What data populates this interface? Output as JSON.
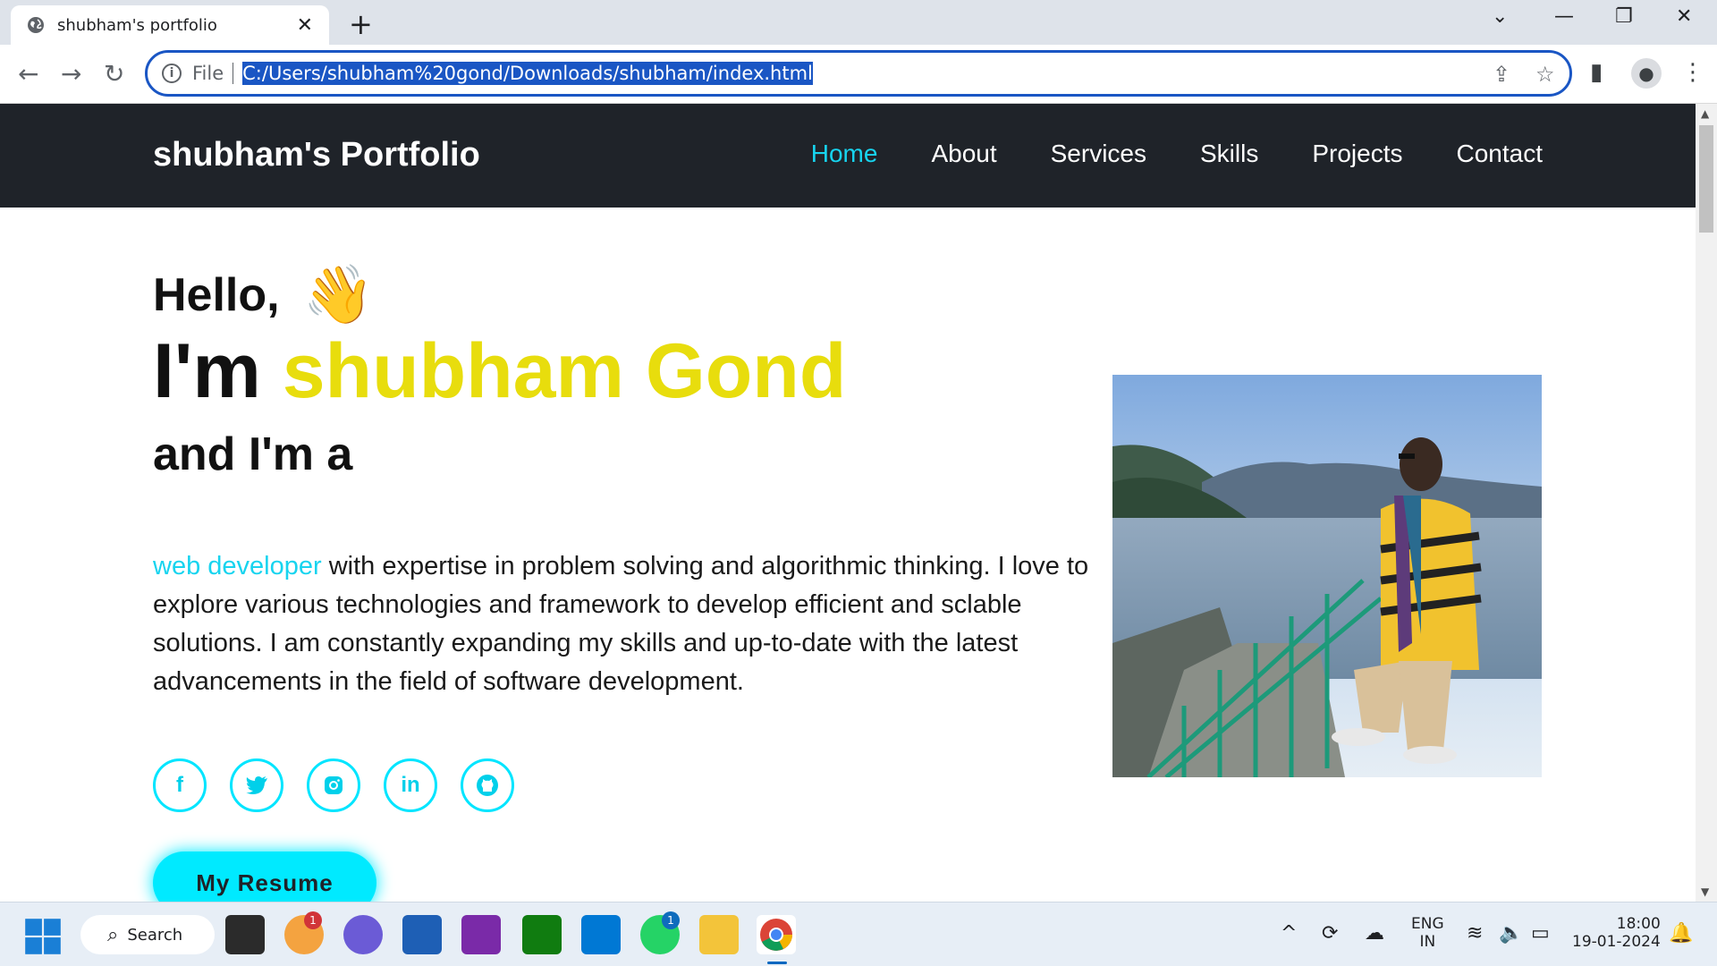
{
  "browser": {
    "tab_title": "shubham's portfolio",
    "new_tab": "+",
    "address_prefix": "File",
    "url": "C:/Users/shubham%20gond/Downloads/shubham/index.html"
  },
  "site": {
    "brand": "shubham's Portfolio",
    "nav": [
      "Home",
      "About",
      "Services",
      "Skills",
      "Projects",
      "Contact"
    ],
    "active_nav": "Home",
    "hello": "Hello,",
    "wave": "👋",
    "iam_prefix": "I'm ",
    "name": "shubham Gond",
    "and_im_a": "and I'm a",
    "role": "web developer",
    "description": " with expertise in problem solving and algorithmic thinking. I love to explore various technologies and framework to develop efficient and sclable solutions. I am constantly expanding my skills and up-to-date with the latest advancements in the field of software development.",
    "socials": [
      {
        "name": "facebook-icon",
        "glyph": "f"
      },
      {
        "name": "twitter-icon",
        "glyph": "🐦"
      },
      {
        "name": "instagram-icon",
        "glyph": "◙"
      },
      {
        "name": "linkedin-icon",
        "glyph": "in"
      },
      {
        "name": "github-icon",
        "glyph": "⌬"
      }
    ],
    "resume_button": "My Resume"
  },
  "taskbar": {
    "search": "Search",
    "lang_top": "ENG",
    "lang_bottom": "IN",
    "time": "18:00",
    "date": "19-01-2024",
    "badges": [
      "1",
      "1"
    ]
  },
  "colors": {
    "accent_cyan": "#17d4ef",
    "name_yellow": "#e8dd0d",
    "navbar_bg": "#1f2329"
  }
}
